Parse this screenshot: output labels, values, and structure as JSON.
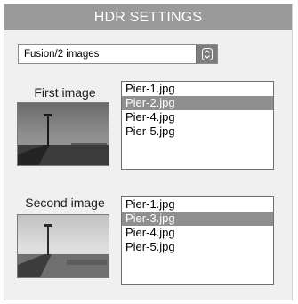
{
  "header": {
    "title": "HDR SETTINGS"
  },
  "mode_select": {
    "value": "Fusion/2 images",
    "icon": "chevron-updown-icon"
  },
  "first": {
    "label": "First image",
    "files": [
      {
        "name": "Pier-1.jpg",
        "selected": false
      },
      {
        "name": "Pier-2.jpg",
        "selected": true
      },
      {
        "name": "Pier-4.jpg",
        "selected": false
      },
      {
        "name": "Pier-5.jpg",
        "selected": false
      }
    ]
  },
  "second": {
    "label": "Second image",
    "files": [
      {
        "name": "Pier-1.jpg",
        "selected": false
      },
      {
        "name": "Pier-3.jpg",
        "selected": true
      },
      {
        "name": "Pier-4.jpg",
        "selected": false
      },
      {
        "name": "Pier-5.jpg",
        "selected": false
      }
    ]
  },
  "colors": {
    "header_bg": "#9a9a9a",
    "selection_bg": "#8f8f8f",
    "panel_bg": "#f0f0f0"
  }
}
